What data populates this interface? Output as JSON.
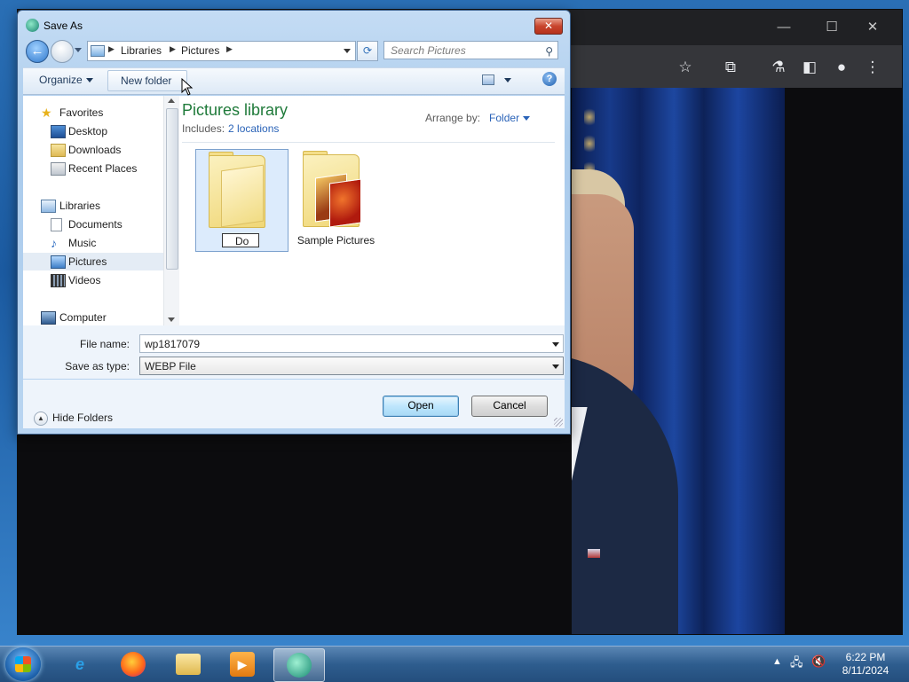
{
  "dialog": {
    "title": "Save As",
    "close_label": "✕",
    "address": {
      "seg1": "Libraries",
      "seg2": "Pictures"
    },
    "search_placeholder": "Search Pictures",
    "toolbar": {
      "organize": "Organize",
      "new_folder": "New folder",
      "help": "?"
    },
    "nav": {
      "favorites": "Favorites",
      "desktop": "Desktop",
      "downloads": "Downloads",
      "recent": "Recent Places",
      "libraries": "Libraries",
      "documents": "Documents",
      "music": "Music",
      "pictures": "Pictures",
      "videos": "Videos",
      "computer": "Computer"
    },
    "library": {
      "title": "Pictures library",
      "includes_label": "Includes:",
      "locations": "2 locations",
      "arrange_label": "Arrange by:",
      "arrange_value": "Folder"
    },
    "items": {
      "new_folder_name": "Do",
      "sample": "Sample Pictures"
    },
    "file_name_label": "File name:",
    "file_name_value": "wp1817079",
    "save_type_label": "Save as type:",
    "save_type_value": "WEBP File",
    "hide_folders": "Hide Folders",
    "open_btn": "Open",
    "cancel_btn": "Cancel"
  },
  "taskbar": {
    "time": "6:22 PM",
    "date": "8/11/2024"
  }
}
